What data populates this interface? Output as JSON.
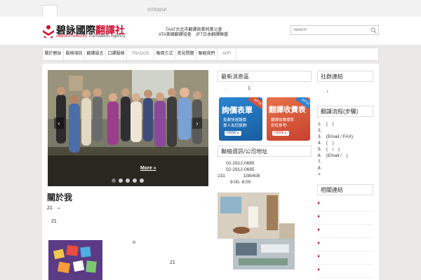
{
  "topbar": {
    "sitemap_label": "SITEMAP"
  },
  "header": {
    "logo_cn_dark": "碧詠國際",
    "logo_cn_red": "翻譯社",
    "logo_en_red": "AlbionProworks",
    "logo_en_dark": " Translation Agency",
    "assoc_line1": "TAAT台北市翻譯商業同業公會",
    "assoc_line2": "ATA美國翻譯協會　JFT日本翻譯聯盟",
    "search_placeholder": "Search"
  },
  "nav": {
    "items": [
      {
        "label": "關於碧詠"
      },
      {
        "label": "服務項目"
      },
      {
        "label": "翻譯語言"
      },
      {
        "label": "口譯服務"
      },
      {
        "label": "TRADOS"
      },
      {
        "label": "報價方式"
      },
      {
        "label": "常見問題"
      },
      {
        "label": "聯絡我們"
      },
      {
        "label": "APP"
      }
    ]
  },
  "slider": {
    "more_label": "More »",
    "prev": "‹",
    "next": "›",
    "dots": 5,
    "active_dot": 0
  },
  "left": {
    "about_title": "關於我",
    "about_line1": "21　–",
    "about_line2": "21",
    "text_o": "o",
    "text_21": "21"
  },
  "middle": {
    "head1": "最新消息區",
    "dot_text": ".",
    "one_text": "1",
    "banner1": {
      "title": "詢價表單",
      "line1": "免費快速報價",
      "line2": "專人為您服務!",
      "here": "HERE ▸",
      "tag": "APTA"
    },
    "banner2": {
      "title": "翻譯收費表",
      "line1": "翻譯收費標準",
      "line2": "供您參考!",
      "here": "HERE ▸",
      "tag": "APTA"
    },
    "head2": "聯絡資訊/公司地址",
    "contact": [
      "02-2912-0685",
      "02-2912-0695",
      "231　　　　108/408",
      "9:00-  6:00"
    ]
  },
  "right": {
    "head1": "社群連結",
    "dot_text": "，",
    "head2": "翻譯流程(步驟)",
    "steps": [
      "1.　(　)",
      "2.",
      "3.　(Email / FAX)",
      "4.　(　)",
      "5.　(　/　)",
      "6.　(Email /　)",
      "7.",
      "8.",
      ">"
    ],
    "head3": "相關連結"
  },
  "colors": {
    "brand_red": "#c8102e",
    "banner1_bg": "#1e6fb5",
    "banner2_bg": "#d9533a"
  }
}
